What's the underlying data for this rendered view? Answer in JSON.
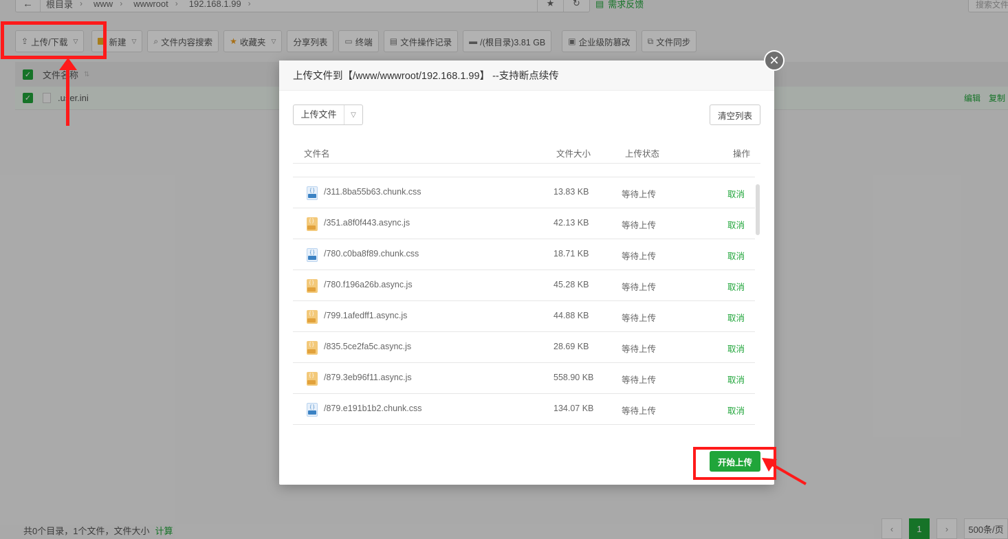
{
  "breadcrumb": [
    "根目录",
    "www",
    "wwwroot",
    "192.168.1.99"
  ],
  "path_buttons": {
    "favorite": "★",
    "refresh": "↻"
  },
  "feedback_label": "需求反馈",
  "search_placeholder": "搜索文件",
  "toolbar": {
    "upload_download": "上传/下载",
    "new": "新建",
    "content_search": "文件内容搜索",
    "favorites": "收藏夹",
    "share_list": "分享列表",
    "terminal": "终端",
    "operation_log": "文件操作记录",
    "disk": "/(根目录)3.81 GB",
    "tamper_proof": "企业级防篡改",
    "file_sync": "文件同步"
  },
  "file_list": {
    "header_name": "文件名称",
    "rows": [
      {
        "name": ".user.ini",
        "ops": [
          "编辑",
          "复制"
        ]
      }
    ]
  },
  "footer": {
    "summary": "共0个目录，1个文件，文件大小",
    "calculate": "计算",
    "current_page": "1",
    "page_size": "500条/页"
  },
  "modal": {
    "title": "上传文件到【/www/wwwroot/192.168.1.99】 --支持断点续传",
    "upload_button": "上传文件",
    "clear_button": "清空列表",
    "start_button": "开始上传",
    "columns": {
      "name": "文件名",
      "size": "文件大小",
      "status": "上传状态",
      "action": "操作"
    },
    "files": [
      {
        "name": "/311.8ba55b63.chunk.css",
        "type": "css",
        "size": "13.83 KB",
        "status": "等待上传",
        "action": "取消"
      },
      {
        "name": "/351.a8f0f443.async.js",
        "type": "js",
        "size": "42.13 KB",
        "status": "等待上传",
        "action": "取消"
      },
      {
        "name": "/780.c0ba8f89.chunk.css",
        "type": "css",
        "size": "18.71 KB",
        "status": "等待上传",
        "action": "取消"
      },
      {
        "name": "/780.f196a26b.async.js",
        "type": "js",
        "size": "45.28 KB",
        "status": "等待上传",
        "action": "取消"
      },
      {
        "name": "/799.1afedff1.async.js",
        "type": "js",
        "size": "44.88 KB",
        "status": "等待上传",
        "action": "取消"
      },
      {
        "name": "/835.5ce2fa5c.async.js",
        "type": "js",
        "size": "28.69 KB",
        "status": "等待上传",
        "action": "取消"
      },
      {
        "name": "/879.3eb96f11.async.js",
        "type": "js",
        "size": "558.90 KB",
        "status": "等待上传",
        "action": "取消"
      },
      {
        "name": "/879.e191b1b2.chunk.css",
        "type": "css",
        "size": "134.07 KB",
        "status": "等待上传",
        "action": "取消"
      }
    ]
  },
  "colors": {
    "accent": "#20a53a",
    "annotation": "#ff1a1a"
  }
}
